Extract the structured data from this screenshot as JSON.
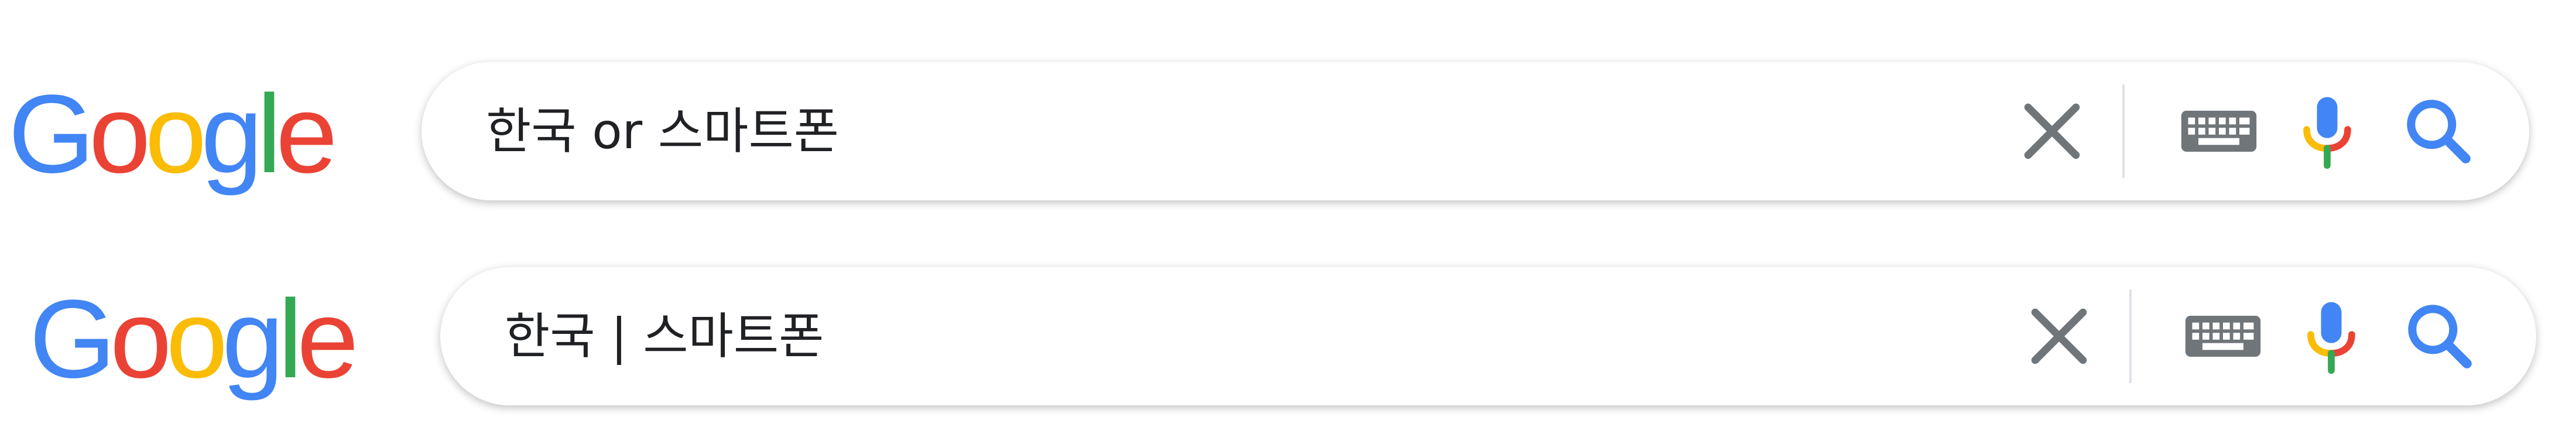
{
  "brand": {
    "logo_letters": [
      "G",
      "o",
      "o",
      "g",
      "l",
      "e"
    ],
    "logo_colors": [
      "#4285F4",
      "#EA4335",
      "#FBBC05",
      "#4285F4",
      "#34A853",
      "#EA4335"
    ]
  },
  "searches": [
    {
      "query": "한국 or 스마트폰"
    },
    {
      "query": "한국 | 스마트폰"
    }
  ],
  "icons": {
    "clear": "close-icon",
    "keyboard": "keyboard-icon",
    "voice": "microphone-icon",
    "search": "search-icon"
  },
  "colors": {
    "icon_gray": "#70757a",
    "search_blue": "#4285F4",
    "divider": "#dfe1e5"
  }
}
